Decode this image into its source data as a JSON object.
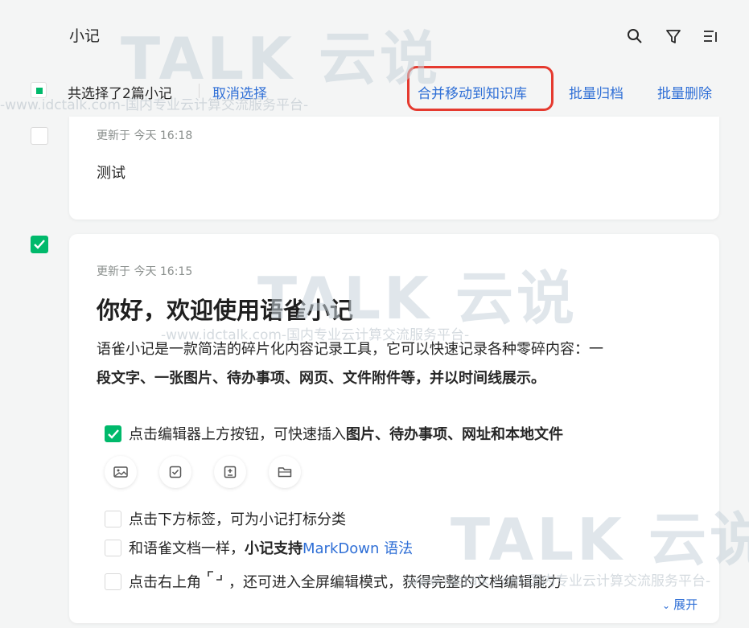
{
  "header": {
    "title": "小记"
  },
  "select_bar": {
    "count_text": "共选择了2篇小记",
    "cancel": "取消选择",
    "merge": "合并移动到知识库",
    "archive": "批量归档",
    "delete": "批量删除"
  },
  "notes": [
    {
      "updated": "更新于 今天 16:18",
      "content": "测试",
      "checked": false
    },
    {
      "updated": "更新于 今天 16:15",
      "heading": "你好，欢迎使用语雀小记",
      "para_1": "语雀小记是一款简洁的碎片化内容记录工具，它可以快速记录各种零碎内容：一",
      "para_2": "段文字、一张图片、待办事项、网页、文件附件等，并以时间线展示。",
      "checked": true,
      "todos": {
        "t1_a": "点击编辑器上方按钮，可快速插入",
        "t1_b": "图片、待办事项、网址和本地文件",
        "t2": "点击下方标签，可为小记打标分类",
        "t3_a": "和语雀文档一样，",
        "t3_b": "小记支持 ",
        "t3_c": "MarkDown 语法",
        "t4_a": "点击右上角",
        "t4_b": "，还可进入全屏编辑模式，获得完整的文档编辑能力"
      },
      "expand": "展开"
    }
  ],
  "watermark": {
    "brand": "TALK 云说",
    "site": "-www.idctalk.com-国内专业云计算交流服务平台-"
  },
  "colors": {
    "accent_green": "#00b96b",
    "link_blue": "#2f6fd6",
    "highlight_red": "#e53a2f"
  }
}
